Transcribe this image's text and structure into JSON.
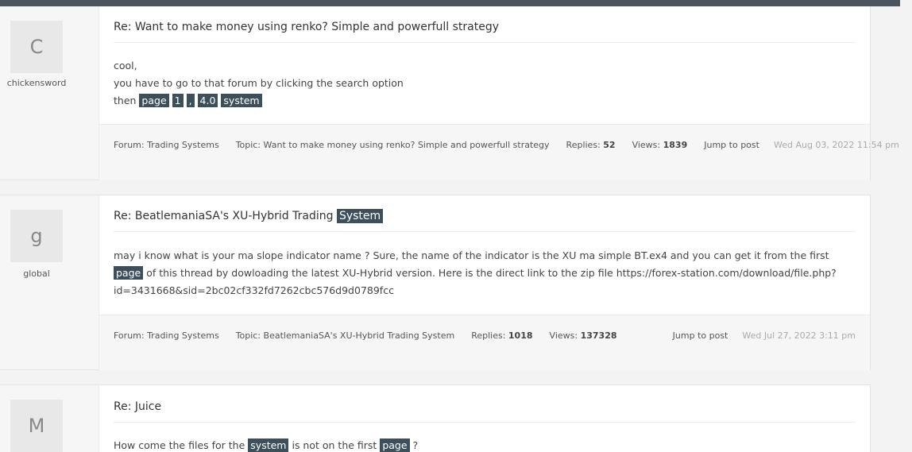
{
  "posts": [
    {
      "avatar_letter": "C",
      "username": "chickensword",
      "title": "Re: Want to make money using renko? Simple and powerfull strategy",
      "lines": [
        "cool,",
        "you have to go to that forum by clicking the search option"
      ],
      "line3_prefix": "then",
      "line3_tokens": [
        "page",
        "1",
        ",",
        "4.0",
        "system"
      ],
      "forum": "Forum: Trading Systems",
      "topic": "Topic: Want to make money using renko? Simple and powerfull strategy",
      "replies_label": "Replies:",
      "replies": "52",
      "views_label": "Views:",
      "views": "1839",
      "jump": "Jump to post",
      "date": "Wed Aug 03, 2022 11:54 pm"
    },
    {
      "avatar_letter": "g",
      "username": "global",
      "title_prefix": "Re: BeatlemaniaSA's XU-Hybrid Trading",
      "title_hl": "System",
      "text_a": "may i know what is your ma slope indicator name ? Sure, the name of the indicator is the XU ma simple BT.ex4 and you can get it from the first",
      "text_hl": "page",
      "text_b": "of this thread by dowloading the latest XU-Hybrid version. Here is the direct link to the zip file https://forex-station.com/download/file.php?id=3431668&sid=2bc02cf332fd7262cbc576d9d0789fcc",
      "forum": "Forum: Trading Systems",
      "topic": "Topic: BeatlemaniaSA's XU-Hybrid Trading System",
      "replies_label": "Replies:",
      "replies": "1018",
      "views_label": "Views:",
      "views": "137328",
      "jump": "Jump to post",
      "date": "Wed Jul 27, 2022 3:11 pm"
    },
    {
      "avatar_letter": "M",
      "title": "Re: Juice",
      "text_a": "How come the files for the",
      "text_hl1": "system",
      "text_b": "is not on the first",
      "text_hl2": "page",
      "text_c": "?"
    }
  ]
}
